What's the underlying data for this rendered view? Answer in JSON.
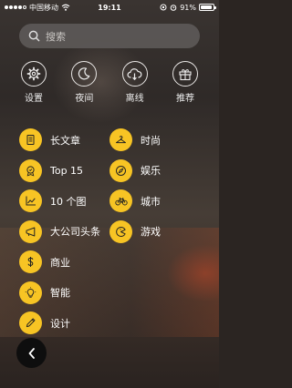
{
  "status_bar": {
    "carrier": "中国移动",
    "time": "19:11",
    "battery_percent": "91%",
    "battery_level": 0.91
  },
  "search": {
    "placeholder": "搜索"
  },
  "top_menu": [
    {
      "label": "设置",
      "icon": "gear-icon"
    },
    {
      "label": "夜间",
      "icon": "moon-icon"
    },
    {
      "label": "离线",
      "icon": "cloud-download-icon"
    },
    {
      "label": "推荐",
      "icon": "gift-icon"
    }
  ],
  "categories_left": [
    {
      "label": "长文章",
      "icon": "document-icon"
    },
    {
      "label": "Top 15",
      "icon": "medal-icon"
    },
    {
      "label": "10 个图",
      "icon": "line-chart-icon"
    },
    {
      "label": "大公司头条",
      "icon": "megaphone-icon"
    },
    {
      "label": "商业",
      "icon": "dollar-icon"
    },
    {
      "label": "智能",
      "icon": "lightbulb-icon"
    },
    {
      "label": "设计",
      "icon": "pencil-icon"
    }
  ],
  "categories_right": [
    {
      "label": "时尚",
      "icon": "hanger-icon"
    },
    {
      "label": "娱乐",
      "icon": "compass-icon"
    },
    {
      "label": "城市",
      "icon": "bicycle-icon"
    },
    {
      "label": "游戏",
      "icon": "pacman-icon"
    }
  ],
  "colors": {
    "accent": "#f7c424",
    "icon_stroke": "#222222"
  }
}
